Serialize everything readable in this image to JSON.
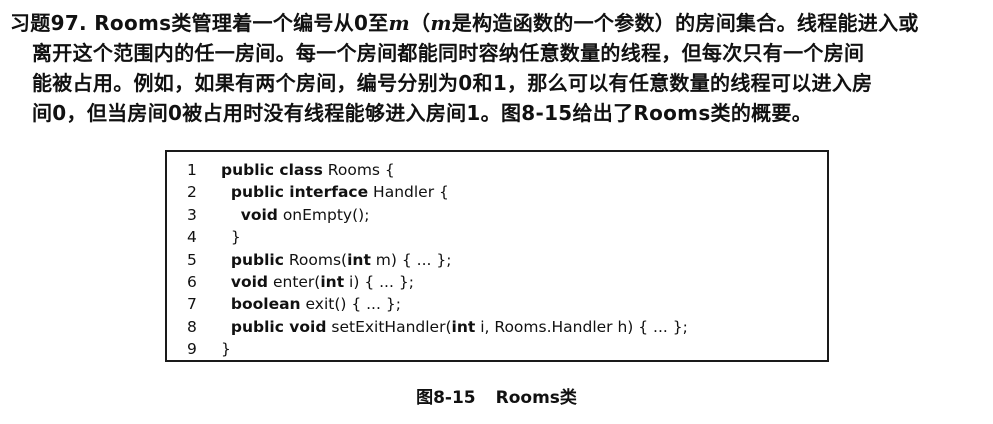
{
  "exercise": {
    "number_label": "习题97.",
    "lines": [
      {
        "segments": [
          {
            "t": " Rooms类管理着一个编号从0至",
            "m": false
          },
          {
            "t": "m",
            "m": true
          },
          {
            "t": "（",
            "m": false
          },
          {
            "t": "m",
            "m": true
          },
          {
            "t": "是构造函数的一个参数）的房间集合。线程能进入或",
            "m": false
          }
        ]
      },
      {
        "segments": [
          {
            "t": "离开这个范围内的任一房间。每一个房间都能同时容纳任意数量的线程，但每次只有一个房间",
            "m": false
          }
        ]
      },
      {
        "segments": [
          {
            "t": "能被占用。例如，如果有两个房间，编号分别为0和1，那么可以有任意数量的线程可以进入房",
            "m": false
          }
        ]
      },
      {
        "segments": [
          {
            "t": "间0，但当房间0被占用时没有线程能够进入房间1。图8-15给出了Rooms类的概要。",
            "m": false
          }
        ]
      }
    ]
  },
  "code": {
    "lines": [
      {
        "n": "1",
        "parts": [
          {
            "t": "public class",
            "k": true
          },
          {
            "t": " Rooms {",
            "k": false
          }
        ]
      },
      {
        "n": "2",
        "parts": [
          {
            "t": "  ",
            "k": false
          },
          {
            "t": "public interface",
            "k": true
          },
          {
            "t": " Handler {",
            "k": false
          }
        ]
      },
      {
        "n": "3",
        "parts": [
          {
            "t": "    ",
            "k": false
          },
          {
            "t": "void",
            "k": true
          },
          {
            "t": " onEmpty();",
            "k": false
          }
        ]
      },
      {
        "n": "4",
        "parts": [
          {
            "t": "  }",
            "k": false
          }
        ]
      },
      {
        "n": "5",
        "parts": [
          {
            "t": "  ",
            "k": false
          },
          {
            "t": "public",
            "k": true
          },
          {
            "t": " Rooms(",
            "k": false
          },
          {
            "t": "int",
            "k": true
          },
          {
            "t": " m) { ... };",
            "k": false
          }
        ]
      },
      {
        "n": "6",
        "parts": [
          {
            "t": "  ",
            "k": false
          },
          {
            "t": "void",
            "k": true
          },
          {
            "t": " enter(",
            "k": false
          },
          {
            "t": "int",
            "k": true
          },
          {
            "t": " i) { ... };",
            "k": false
          }
        ]
      },
      {
        "n": "7",
        "parts": [
          {
            "t": "  ",
            "k": false
          },
          {
            "t": "boolean",
            "k": true
          },
          {
            "t": " exit() { ... };",
            "k": false
          }
        ]
      },
      {
        "n": "8",
        "parts": [
          {
            "t": "  ",
            "k": false
          },
          {
            "t": "public void",
            "k": true
          },
          {
            "t": " setExitHandler(",
            "k": false
          },
          {
            "t": "int",
            "k": true
          },
          {
            "t": " i, Rooms.Handler h) { ... };",
            "k": false
          }
        ]
      },
      {
        "n": "9",
        "parts": [
          {
            "t": "}",
            "k": false
          }
        ]
      }
    ]
  },
  "figure_caption": {
    "label": "图8-15",
    "title": "Rooms类"
  }
}
